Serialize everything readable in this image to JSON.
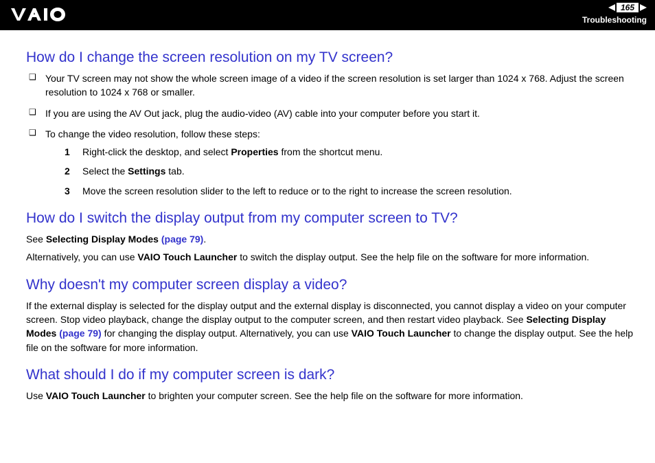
{
  "header": {
    "page_number": "165",
    "section": "Troubleshooting"
  },
  "q1": {
    "title": "How do I change the screen resolution on my TV screen?",
    "b1": "Your TV screen may not show the whole screen image of a video if the screen resolution is set larger than 1024 x 768. Adjust the screen resolution to 1024 x 768 or smaller.",
    "b2": "If you are using the AV Out jack, plug the audio-video (AV) cable into your computer before you start it.",
    "b3": "To change the video resolution, follow these steps:",
    "s1a": "Right-click the desktop, and select ",
    "s1b": "Properties",
    "s1c": " from the shortcut menu.",
    "s2a": "Select the ",
    "s2b": "Settings",
    "s2c": " tab.",
    "s3": "Move the screen resolution slider to the left to reduce or to the right to increase the screen resolution."
  },
  "q2": {
    "title": "How do I switch the display output from my computer screen to TV?",
    "p1a": "See ",
    "p1b": "Selecting Display Modes ",
    "p1c": "(page 79)",
    "p1d": ".",
    "p2a": "Alternatively, you can use ",
    "p2b": "VAIO Touch Launcher",
    "p2c": " to switch the display output. See the help file on the software for more information."
  },
  "q3": {
    "title": "Why doesn't my computer screen display a video?",
    "p1a": "If the external display is selected for the display output and the external display is disconnected, you cannot display a video on your computer screen. Stop video playback, change the display output to the computer screen, and then restart video playback. See ",
    "p1b": "Selecting Display Modes ",
    "p1c": "(page 79)",
    "p1d": " for changing the display output. Alternatively, you can use ",
    "p1e": "VAIO Touch Launcher",
    "p1f": " to change the display output. See the help file on the software for more information."
  },
  "q4": {
    "title": "What should I do if my computer screen is dark?",
    "p1a": "Use ",
    "p1b": "VAIO Touch Launcher",
    "p1c": " to brighten your computer screen. See the help file on the software for more information."
  }
}
